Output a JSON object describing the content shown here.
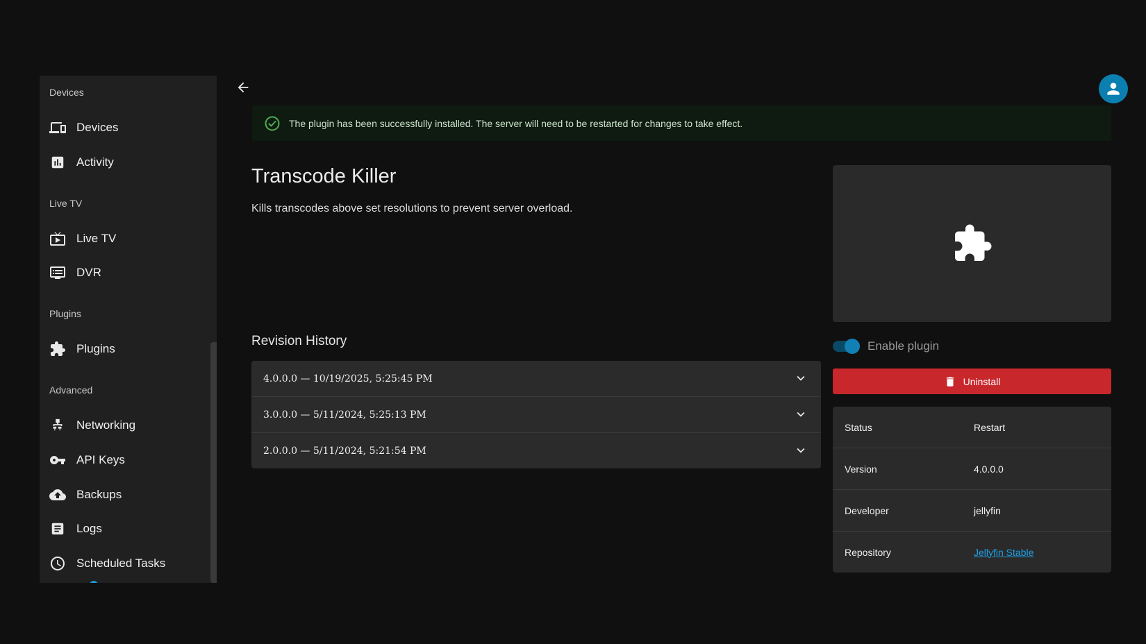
{
  "sidebar": {
    "sections": {
      "devices": "Devices",
      "livetv": "Live TV",
      "plugins": "Plugins",
      "advanced": "Advanced"
    },
    "items": [
      {
        "label": "Devices",
        "icon": "devices-icon"
      },
      {
        "label": "Activity",
        "icon": "activity-icon"
      },
      {
        "label": "Live TV",
        "icon": "live-tv-icon"
      },
      {
        "label": "DVR",
        "icon": "dvr-icon"
      },
      {
        "label": "Plugins",
        "icon": "puzzle-icon"
      },
      {
        "label": "Networking",
        "icon": "network-icon"
      },
      {
        "label": "API Keys",
        "icon": "key-icon"
      },
      {
        "label": "Backups",
        "icon": "cloud-upload-icon"
      },
      {
        "label": "Logs",
        "icon": "logs-icon"
      },
      {
        "label": "Scheduled Tasks",
        "icon": "clock-icon"
      }
    ]
  },
  "alert": {
    "message": "The plugin has been successfully installed. The server will need to be restarted for changes to take effect.",
    "icon": "check-circle-icon"
  },
  "plugin": {
    "name": "Transcode Killer",
    "description": "Kills transcodes above set resolutions to prevent server overload."
  },
  "revisions": {
    "title": "Revision History",
    "items": [
      "4.0.0.0 — 10/19/2025, 5:25:45 PM",
      "3.0.0.0 — 5/11/2024, 5:25:13 PM",
      "2.0.0.0 — 5/11/2024, 5:21:54 PM"
    ]
  },
  "controls": {
    "enable_label": "Enable plugin",
    "enabled": true,
    "uninstall_label": "Uninstall"
  },
  "info": {
    "status_key": "Status",
    "status_val": "Restart",
    "version_key": "Version",
    "version_val": "4.0.0.0",
    "developer_key": "Developer",
    "developer_val": "jellyfin",
    "repository_key": "Repository",
    "repository_val": "Jellyfin Stable"
  },
  "colors": {
    "accent": "#1280b5",
    "danger": "#c8272c",
    "success": "#4caf50",
    "link": "#1ea0e6"
  }
}
